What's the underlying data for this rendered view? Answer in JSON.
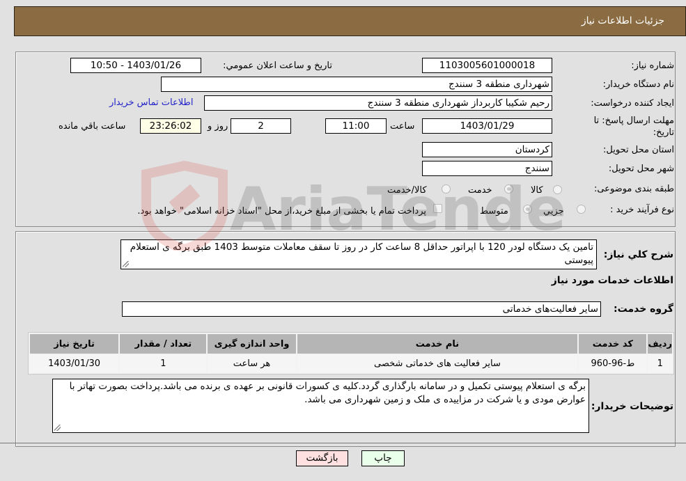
{
  "header": {
    "title": "جزئیات اطلاعات نیاز"
  },
  "form": {
    "need_number": {
      "label": "شماره نیاز:",
      "value": "1103005601000018"
    },
    "announce_datetime": {
      "label": "تاریخ و ساعت اعلان عمومي:",
      "value": "1403/01/26 - 10:50"
    },
    "buyer_org": {
      "label": "نام دستگاه خريدار:",
      "value": "شهرداری منطقه 3 سنندج"
    },
    "requester": {
      "label": "ايجاد کننده درخواست:",
      "value": "رحیم شکیبا کاربرداز شهرداری منطقه 3 سنندج"
    },
    "buyer_contact_link": "اطلاعات تماس خريدار",
    "deadline": {
      "label": "مهلت ارسال پاسخ: تا تاریخ:",
      "date": "1403/01/29",
      "time_label": "ساعت",
      "time": "11:00",
      "days": "2",
      "days_label": "روز و",
      "remaining": "23:26:02",
      "remaining_label": "ساعت باقي مانده"
    },
    "province": {
      "label": "استان محل تحويل:",
      "value": "کردستان"
    },
    "city": {
      "label": "شهر محل تحويل:",
      "value": "سنندج"
    },
    "category": {
      "label": "طبقه بندی موضوعی:",
      "options": [
        "کالا",
        "خدمت",
        "کالا/خدمت"
      ],
      "selected": "خدمت"
    },
    "purchase_type": {
      "label": "نوع فرآيند خريد :",
      "options": [
        "جزيي",
        "متوسط"
      ],
      "selected": "متوسط",
      "treasury_checkbox_label": "پرداخت تمام یا بخشی از مبلغ خرید،از محل \"اسناد خزانه اسلامی\" خواهد بود.",
      "treasury_checked": false
    }
  },
  "description": {
    "label": "شرح کلي نياز:",
    "value": "تامین  یک دستگاه لودر 120 با اپراتور حداقل 8 ساعت کار در روز تا سقف معاملات متوسط 1403 طبق برگه ی استعلام پیوستی"
  },
  "services": {
    "section_title": "اطلاعات خدمات مورد نياز",
    "group_label": "گروه خدمت:",
    "group_value": "سایر فعالیت‌های خدماتی",
    "table": {
      "headers": [
        "رديف",
        "کد خدمت",
        "نام خدمت",
        "واحد اندازه گیری",
        "تعداد / مقدار",
        "تاريخ نياز"
      ],
      "rows": [
        [
          "1",
          "ط-96-960",
          "سایر فعالیت های خدماتی شخصی",
          "هر ساعت",
          "1",
          "1403/01/30"
        ]
      ]
    }
  },
  "buyer_notes": {
    "label": "توضيحات خريدار:",
    "value": "برگه ی استعلام پیوستی تکمیل و در سامانه بارگذاری گردد.کلیه ی کسورات قانونی بر عهده ی برنده می باشد.پرداخت بصورت تهاتر با عوارض مودی و یا شرکت در مزاییده ی ملک و زمین شهرداری می باشد."
  },
  "buttons": {
    "print": "چاپ",
    "back": "بازگشت"
  },
  "watermark": {
    "text": "AriaTender.neT",
    "brand_color": "#d9534f"
  }
}
